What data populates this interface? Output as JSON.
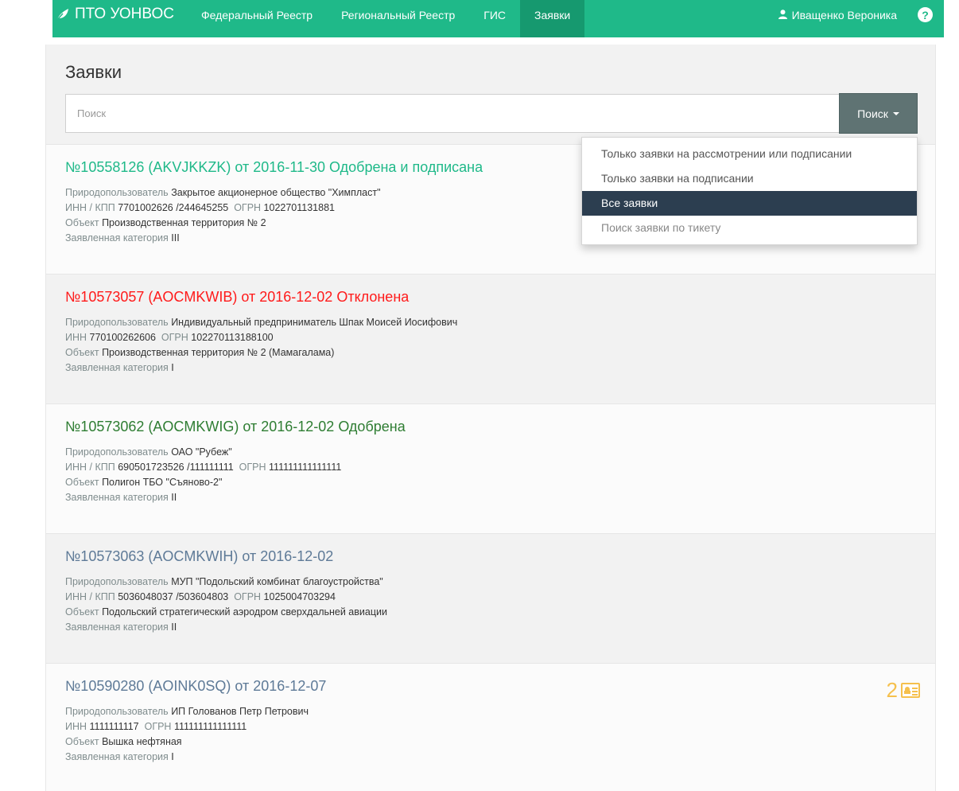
{
  "navbar": {
    "brand": "ПТО УОНВОС",
    "items": [
      {
        "label": "Федеральный Реестр"
      },
      {
        "label": "Региональный Реестр"
      },
      {
        "label": "ГИС"
      },
      {
        "label": "Заявки"
      }
    ],
    "active_item": "Заявки",
    "user": "Иващенко Вероника",
    "help": "?"
  },
  "page": {
    "title": "Заявки",
    "search_placeholder": "Поиск",
    "search_button": "Поиск"
  },
  "dropdown": {
    "items": [
      {
        "label": "Только заявки на рассмотрении или подписании"
      },
      {
        "label": "Только заявки на подписании"
      },
      {
        "label": "Все заявки"
      },
      {
        "label": "Поиск заявки по тикету"
      }
    ],
    "selected": "Все заявки"
  },
  "applications": [
    {
      "title": "№10558126 (AKVJKKZK) от 2016-11-30 Одобрена и подписана",
      "status_color": "#1fb989",
      "user_label": "Природопользователь",
      "user_value": "Закрытое акционерное общество \"Химпласт\"",
      "inn_label": "ИНН / КПП",
      "inn_value": "7701002626 /244645255",
      "ogrn_label": "ОГРН",
      "ogrn_value": "1022701131881",
      "object_label": "Объект",
      "object_value": "Производственная территория № 2",
      "category_label": "Заявленная категория",
      "category_value": "III"
    },
    {
      "title": "№10573057 (AOCMKWIB) от 2016-12-02 Отклонена",
      "status_color": "#ff1a1a",
      "user_label": "Природопользователь",
      "user_value": "Индивидуальный предприниматель Шпак Моисей Иосифович",
      "inn_label": "ИНН",
      "inn_value": "770100262606",
      "ogrn_label": "ОГРН",
      "ogrn_value": "102270113188100",
      "object_label": "Объект",
      "object_value": "Производственная территория № 2 (Мамагалама)",
      "category_label": "Заявленная категория",
      "category_value": "I"
    },
    {
      "title": "№10573062 (AOCMKWIG) от 2016-12-02 Одобрена",
      "status_color": "#2e7d32",
      "user_label": "Природопользователь",
      "user_value": "ОАО \"Рубеж\"",
      "inn_label": "ИНН / КПП",
      "inn_value": "690501723526 /111111111",
      "ogrn_label": "ОГРН",
      "ogrn_value": "111111111111111",
      "object_label": "Объект",
      "object_value": "Полигон ТБО \"Съяново-2\"",
      "category_label": "Заявленная категория",
      "category_value": "II"
    },
    {
      "title": "№10573063 (AOCMKWIH) от 2016-12-02",
      "status_color": "#5e7a97",
      "user_label": "Природопользователь",
      "user_value": "МУП \"Подольский комбинат благоустройства\"",
      "inn_label": "ИНН / КПП",
      "inn_value": "5036048037 /503604803",
      "ogrn_label": "ОГРН",
      "ogrn_value": "1025004703294",
      "object_label": "Объект",
      "object_value": "Подольский стратегический аэродром сверхдальней авиации",
      "category_label": "Заявленная категория",
      "category_value": "II"
    },
    {
      "title": "№10590280 (AOINK0SQ) от 2016-12-07",
      "status_color": "#5e7a97",
      "user_label": "Природопользователь",
      "user_value": "ИП Голованов Петр Петрович",
      "inn_label": "ИНН",
      "inn_value": "1111111117",
      "ogrn_label": "ОГРН",
      "ogrn_value": "111111111111111",
      "object_label": "Объект",
      "object_value": "Вышка нефтяная",
      "category_label": "Заявленная категория",
      "category_value": "I",
      "badge_count": "2",
      "badge_icon": "id-card-icon"
    }
  ]
}
